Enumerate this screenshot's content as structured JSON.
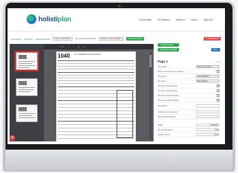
{
  "brand": {
    "name_a": "holisti",
    "name_b": "plan"
  },
  "nav": [
    "Households",
    "Tax Returns",
    "Admin ▾",
    "Help ▾",
    "Sign Out"
  ],
  "toolbar": {
    "links": [
      "Household",
      "Tax Room",
      "Analysis Details"
    ],
    "year_select": "Year to 2019 Return",
    "doc_label": "Document Household Tax",
    "doc_select": "Matthew James and Ellen",
    "upload_btn": "Upload Document",
    "delete_btn": "✕ Delete Return"
  },
  "viewer": {
    "page_indicator": "1 / 2",
    "zoom_out": "—",
    "zoom_in": "+",
    "form_number": "1040",
    "form_title": "U.S. Individual Income Tax Return"
  },
  "panel": {
    "btn_flag": "✓ Flag Complete",
    "btn_save": "Save Return Modified",
    "btn_next": "Next ›",
    "title": "Page 1",
    "page_num": "1 / 2",
    "rows": [
      {
        "label": "Filing status",
        "type": "select",
        "value": "Married Filing Joint"
      },
      {
        "label": "Was not occupied by any together",
        "type": "checkbox"
      },
      {
        "label": "Tax payer 1",
        "type": "select",
        "value": "James Matthew"
      },
      {
        "label": "Tax payer 2",
        "type": "select",
        "value": "Ellen Matthew"
      },
      {
        "label": "Tax payer 1 blind this age",
        "type": "checkbox"
      },
      {
        "label": "Tax payer 2 blind this age",
        "type": "checkbox"
      },
      {
        "label": "Tax payer 1 blind this (alive)",
        "type": "checkbox"
      },
      {
        "label": "Tax payer 2 blind this (alive)",
        "type": "checkbox"
      },
      {
        "label": "Dependents",
        "type": "text",
        "value": ""
      },
      {
        "label": "Child tax credit dependent",
        "type": "text",
        "value": ""
      },
      {
        "label": "Other credit dependent",
        "type": "text",
        "value": ""
      },
      {
        "label": "Wages",
        "type": "text",
        "value": "111,480.00"
      },
      {
        "label": "Tax-exempt interest",
        "type": "text",
        "value": "0.00"
      },
      {
        "label": "Taxable interest",
        "type": "text",
        "value": "10.00"
      }
    ]
  }
}
